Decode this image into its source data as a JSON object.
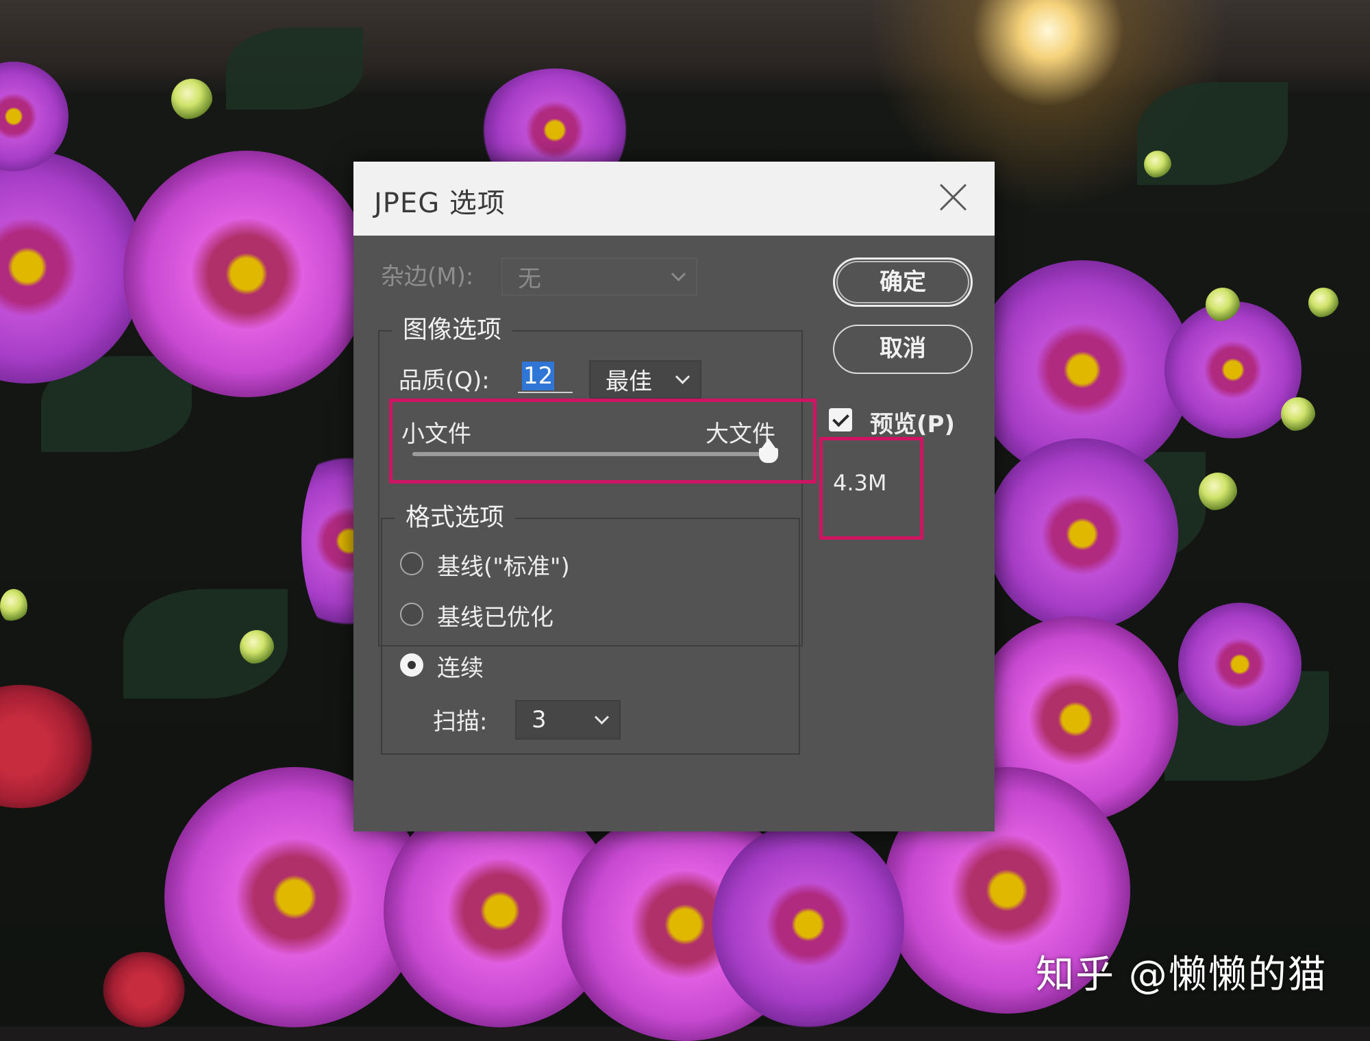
{
  "dialog": {
    "title": "JPEG 选项",
    "close_icon": "close-icon",
    "matte": {
      "label": "杂边(M):",
      "value": "无"
    },
    "image_options": {
      "title": "图像选项",
      "quality_label": "品质(Q):",
      "quality_value": "12",
      "quality_preset": "最佳",
      "small_file_label": "小文件",
      "large_file_label": "大文件",
      "slider_fraction": 1.0
    },
    "format_options": {
      "title": "格式选项",
      "options": [
        {
          "label": "基线(\"标准\")",
          "checked": false
        },
        {
          "label": "基线已优化",
          "checked": false
        },
        {
          "label": "连续",
          "checked": true
        }
      ],
      "scans_label": "扫描:",
      "scans_value": "3"
    },
    "buttons": {
      "ok": "确定",
      "cancel": "取消"
    },
    "preview": {
      "label": "预览(P)",
      "checked": true
    },
    "file_size": "4.3M"
  },
  "highlight_color": "#d01464",
  "watermark": "知乎 @懒懒的猫"
}
